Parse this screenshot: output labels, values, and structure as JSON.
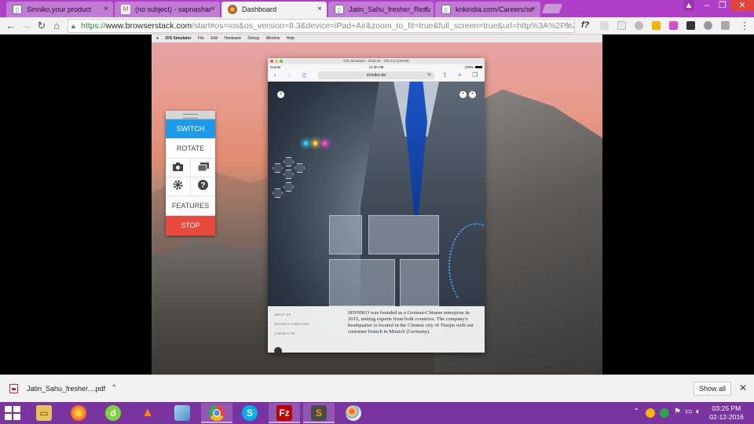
{
  "browser": {
    "tabs": [
      {
        "label": "Sinniko,your product",
        "icon": "document-icon",
        "active": false
      },
      {
        "label": "(no subject) - sapnashar",
        "icon": "gmail-icon",
        "active": false
      },
      {
        "label": "Dashboard",
        "icon": "chrome-icon",
        "active": true
      },
      {
        "label": "Jatin_Sahu_fresher_Resu",
        "icon": "document-icon",
        "active": false
      },
      {
        "label": "knkindia.com/Careers/se",
        "icon": "document-icon",
        "active": false
      }
    ],
    "url": {
      "protocol": "https://",
      "host": "www.browserstack.com",
      "path": "/start#os=ios&os_version=8.3&device=iPad+Air&zoom_to_fit=true&full_screen=true&url=http%3A%2F%2Fs"
    },
    "extension_label": "f?"
  },
  "mac": {
    "menu": [
      "iOS Simulator",
      "File",
      "Edit",
      "Hardware",
      "Debug",
      "Window",
      "Help"
    ]
  },
  "browserstack": {
    "switch": "SWITCH",
    "rotate": "ROTATE",
    "features": "FEATURES",
    "stop": "STOP"
  },
  "simulator": {
    "title": "iOS Simulator - iPad Air - iOS 8.3 (12F69)",
    "carrier": "Carrier",
    "time": "11:30 AM",
    "battery": "100%",
    "url": "sinniko.de"
  },
  "site": {
    "nav": [
      "ABOUT US",
      "PRODUCT PORTFOLIO",
      "CONTACT US"
    ],
    "about": "SINNIKO was founded as a German-Chinese enterprise in 2015, uniting experts from both countries. The company's headquarter is located in the Chinese city of Tianjin with our customer branch in Munich (Germany)."
  },
  "downloads": {
    "filename": "Jatin_Sahu_fresher....pdf",
    "show_all": "Show all"
  },
  "taskbar": {
    "icons": [
      "file-explorer-icon",
      "firefox-icon",
      "dreamweaver-icon",
      "vlc-icon",
      "notepad-icon",
      "chrome-icon",
      "skype-icon",
      "filezilla-icon",
      "sublime-text-icon",
      "paint-icon"
    ],
    "time": "03:25 PM",
    "date": "02-12-2016"
  },
  "colors": {
    "tabbar": "#b03fc8",
    "taskbar": "#7a34a0",
    "switch": "#1e9be8",
    "stop": "#e8493d"
  }
}
